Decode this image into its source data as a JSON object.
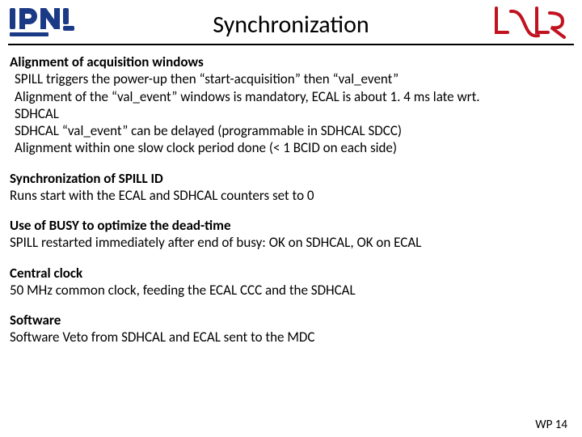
{
  "title": "Synchronization",
  "sections": {
    "s1": {
      "title": "Alignment of acquisition windows",
      "l1": "SPILL triggers the power-up then “start-acquisition” then “val_event”",
      "l2": "Alignment of the “val_event” windows is mandatory, ECAL is about 1. 4 ms late wrt.",
      "l3": "SDHCAL",
      "l4": "SDHCAL “val_event” can be delayed (programmable in SDHCAL SDCC)",
      "l5": "Alignment within one slow clock period done (< 1 BCID on each side)"
    },
    "s2": {
      "title": "Synchronization of SPILL ID",
      "l1": "Runs start with the ECAL and SDHCAL counters set to 0"
    },
    "s3": {
      "title": "Use of BUSY to optimize the dead-time",
      "l1": "SPILL restarted immediately after end of busy: OK on SDHCAL, OK on ECAL"
    },
    "s4": {
      "title": "Central clock",
      "l1": "50 MHz common clock, feeding the ECAL CCC and the SDHCAL"
    },
    "s5": {
      "title": "Software",
      "l1": "Software Veto from SDHCAL and ECAL sent to the MDC"
    }
  },
  "footer": "WP 14"
}
